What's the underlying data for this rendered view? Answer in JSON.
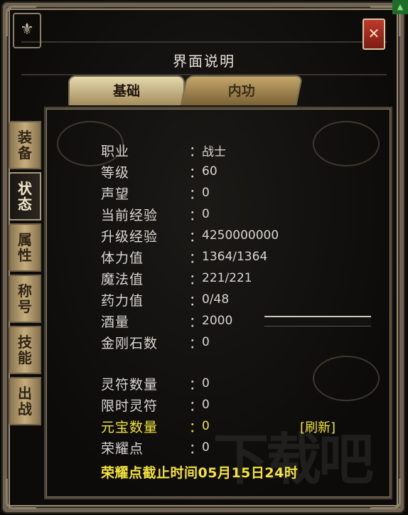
{
  "window": {
    "title": "界面说明",
    "close_icon": "close-icon",
    "corner_ornament": "ornament-icon"
  },
  "tabs": {
    "basic": "基础",
    "inner": "内功"
  },
  "side_tabs": [
    {
      "chars": [
        "装",
        "备"
      ]
    },
    {
      "chars": [
        "状",
        "态"
      ]
    },
    {
      "chars": [
        "属",
        "性"
      ]
    },
    {
      "chars": [
        "称",
        "号"
      ]
    },
    {
      "chars": [
        "技",
        "能"
      ]
    },
    {
      "chars": [
        "出",
        "战"
      ]
    }
  ],
  "stats": [
    {
      "label": "职业",
      "sep": "：",
      "value": "战士"
    },
    {
      "label": "等级",
      "sep": "：",
      "value": "60"
    },
    {
      "label": "声望",
      "sep": "：",
      "value": "0"
    },
    {
      "label": "当前经验",
      "sep": "：",
      "value": "0"
    },
    {
      "label": "升级经验",
      "sep": "：",
      "value": "4250000000"
    },
    {
      "label": "体力值",
      "sep": "：",
      "value": "1364/1364"
    },
    {
      "label": "魔法值",
      "sep": "：",
      "value": "221/221"
    },
    {
      "label": "药力值",
      "sep": "：",
      "value": "0/48"
    },
    {
      "label": "酒量",
      "sep": "：",
      "value": "2000"
    },
    {
      "label": "金刚石数",
      "sep": "：",
      "value": "0"
    }
  ],
  "stats2": [
    {
      "label": "灵符数量",
      "sep": "：",
      "value": "0"
    },
    {
      "label": "限时灵符",
      "sep": "：",
      "value": "0"
    },
    {
      "label": "元宝数量",
      "sep": "：",
      "value": "0"
    },
    {
      "label": "荣耀点",
      "sep": "：",
      "value": "0"
    }
  ],
  "refresh_label": "[刷新]",
  "notice": "荣耀点截止时间05月15日24时",
  "watermark": "下载吧"
}
